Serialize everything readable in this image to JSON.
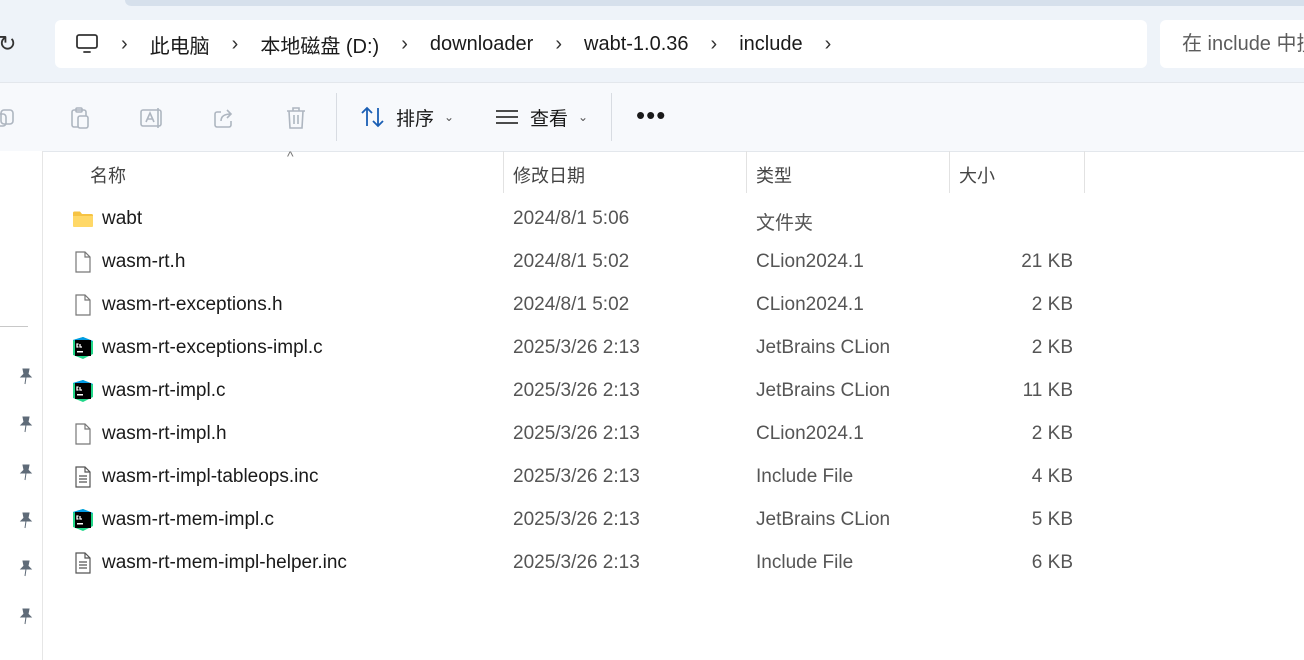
{
  "address": {
    "crumbs": [
      "此电脑",
      "本地磁盘 (D:)",
      "downloader",
      "wabt-1.0.36",
      "include"
    ],
    "separator": "›"
  },
  "search": {
    "placeholder": "在 include 中搜"
  },
  "toolbar": {
    "sort_label": "排序",
    "view_label": "查看",
    "more_label": "•••"
  },
  "columns": {
    "name": "名称",
    "date": "修改日期",
    "type": "类型",
    "size": "大小"
  },
  "files": [
    {
      "icon": "folder-icon",
      "name": "wabt",
      "date": "2024/8/1 5:06",
      "type": "文件夹",
      "size": ""
    },
    {
      "icon": "file-icon",
      "name": "wasm-rt.h",
      "date": "2024/8/1 5:02",
      "type": "CLion2024.1",
      "size": "21 KB"
    },
    {
      "icon": "file-icon",
      "name": "wasm-rt-exceptions.h",
      "date": "2024/8/1 5:02",
      "type": "CLion2024.1",
      "size": "2 KB"
    },
    {
      "icon": "clion-icon",
      "name": "wasm-rt-exceptions-impl.c",
      "date": "2025/3/26 2:13",
      "type": "JetBrains CLion",
      "size": "2 KB"
    },
    {
      "icon": "clion-icon",
      "name": "wasm-rt-impl.c",
      "date": "2025/3/26 2:13",
      "type": "JetBrains CLion",
      "size": "11 KB"
    },
    {
      "icon": "file-icon",
      "name": "wasm-rt-impl.h",
      "date": "2025/3/26 2:13",
      "type": "CLion2024.1",
      "size": "2 KB"
    },
    {
      "icon": "text-file-icon",
      "name": "wasm-rt-impl-tableops.inc",
      "date": "2025/3/26 2:13",
      "type": "Include File",
      "size": "4 KB"
    },
    {
      "icon": "clion-icon",
      "name": "wasm-rt-mem-impl.c",
      "date": "2025/3/26 2:13",
      "type": "JetBrains CLion",
      "size": "5 KB"
    },
    {
      "icon": "text-file-icon",
      "name": "wasm-rt-mem-impl-helper.inc",
      "date": "2025/3/26 2:13",
      "type": "Include File",
      "size": "6 KB"
    }
  ],
  "colors": {
    "topbar": "#eef3f9",
    "folder": "#f6c343",
    "clion_green": "#21d789"
  }
}
